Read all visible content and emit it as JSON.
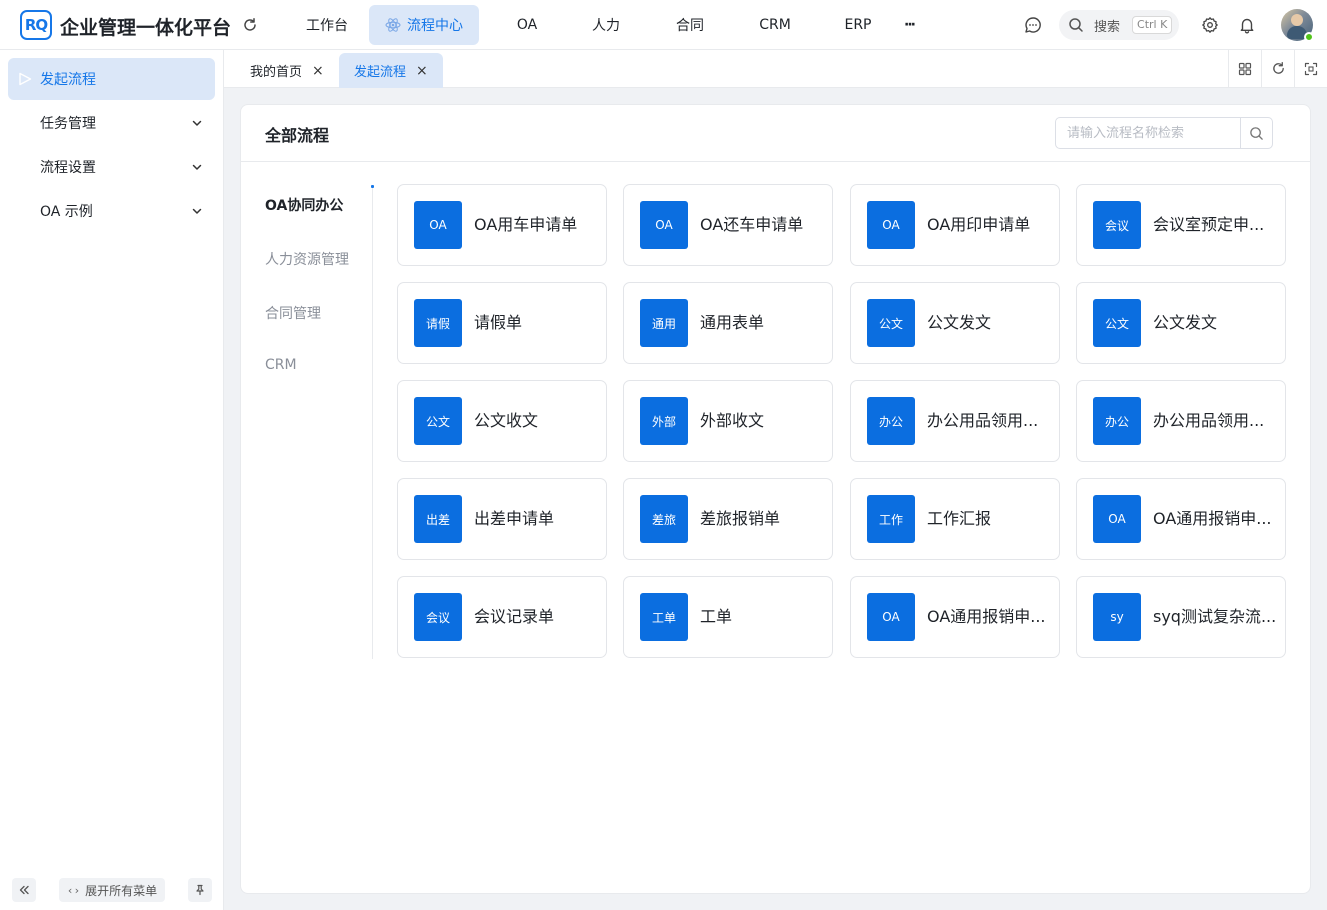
{
  "app": {
    "logo_text": "RQ",
    "title": "企业管理一体化平台"
  },
  "header": {
    "nav": [
      {
        "label": "工作台"
      },
      {
        "label": "流程中心"
      },
      {
        "label": "OA"
      },
      {
        "label": "人力"
      },
      {
        "label": "合同"
      },
      {
        "label": "CRM"
      },
      {
        "label": "ERP"
      },
      {
        "label": "···"
      }
    ],
    "active_nav": "流程中心",
    "search": {
      "label": "搜索",
      "shortcut": "Ctrl K"
    }
  },
  "sidebar": {
    "items": [
      {
        "label": "发起流程",
        "active": true
      },
      {
        "label": "任务管理",
        "active": false
      },
      {
        "label": "流程设置",
        "active": false
      },
      {
        "label": "OA 示例",
        "active": false
      }
    ],
    "footer": {
      "expand_label": "展开所有菜单",
      "expand_icon": "‹›"
    }
  },
  "tabs": [
    {
      "label": "我的首页",
      "active": false
    },
    {
      "label": "发起流程",
      "active": true
    }
  ],
  "card": {
    "title": "全部流程",
    "search_placeholder": "请输入流程名称检索"
  },
  "categories": [
    {
      "label": "OA协同办公",
      "active": true
    },
    {
      "label": "人力资源管理",
      "active": false
    },
    {
      "label": "合同管理",
      "active": false
    },
    {
      "label": "CRM",
      "active": false
    }
  ],
  "processes": [
    {
      "badge": "OA",
      "name": "OA用车申请单"
    },
    {
      "badge": "OA",
      "name": "OA还车申请单"
    },
    {
      "badge": "OA",
      "name": "OA用印申请单"
    },
    {
      "badge": "会议",
      "name": "会议室预定申..."
    },
    {
      "badge": "请假",
      "name": "请假单"
    },
    {
      "badge": "通用",
      "name": "通用表单"
    },
    {
      "badge": "公文",
      "name": "公文发文"
    },
    {
      "badge": "公文",
      "name": "公文发文"
    },
    {
      "badge": "公文",
      "name": "公文收文"
    },
    {
      "badge": "外部",
      "name": "外部收文"
    },
    {
      "badge": "办公",
      "name": "办公用品领用..."
    },
    {
      "badge": "办公",
      "name": "办公用品领用..."
    },
    {
      "badge": "出差",
      "name": "出差申请单"
    },
    {
      "badge": "差旅",
      "name": "差旅报销单"
    },
    {
      "badge": "工作",
      "name": "工作汇报"
    },
    {
      "badge": "OA",
      "name": "OA通用报销申..."
    },
    {
      "badge": "会议",
      "name": "会议记录单"
    },
    {
      "badge": "工单",
      "name": "工单"
    },
    {
      "badge": "OA",
      "name": "OA通用报销申..."
    },
    {
      "badge": "sy",
      "name": "syq测试复杂流..."
    }
  ],
  "colors": {
    "accent": "#1677e8",
    "badge_bg": "#0b6ee0",
    "active_bg": "#dbe7f8",
    "status_online": "#52c41a"
  }
}
